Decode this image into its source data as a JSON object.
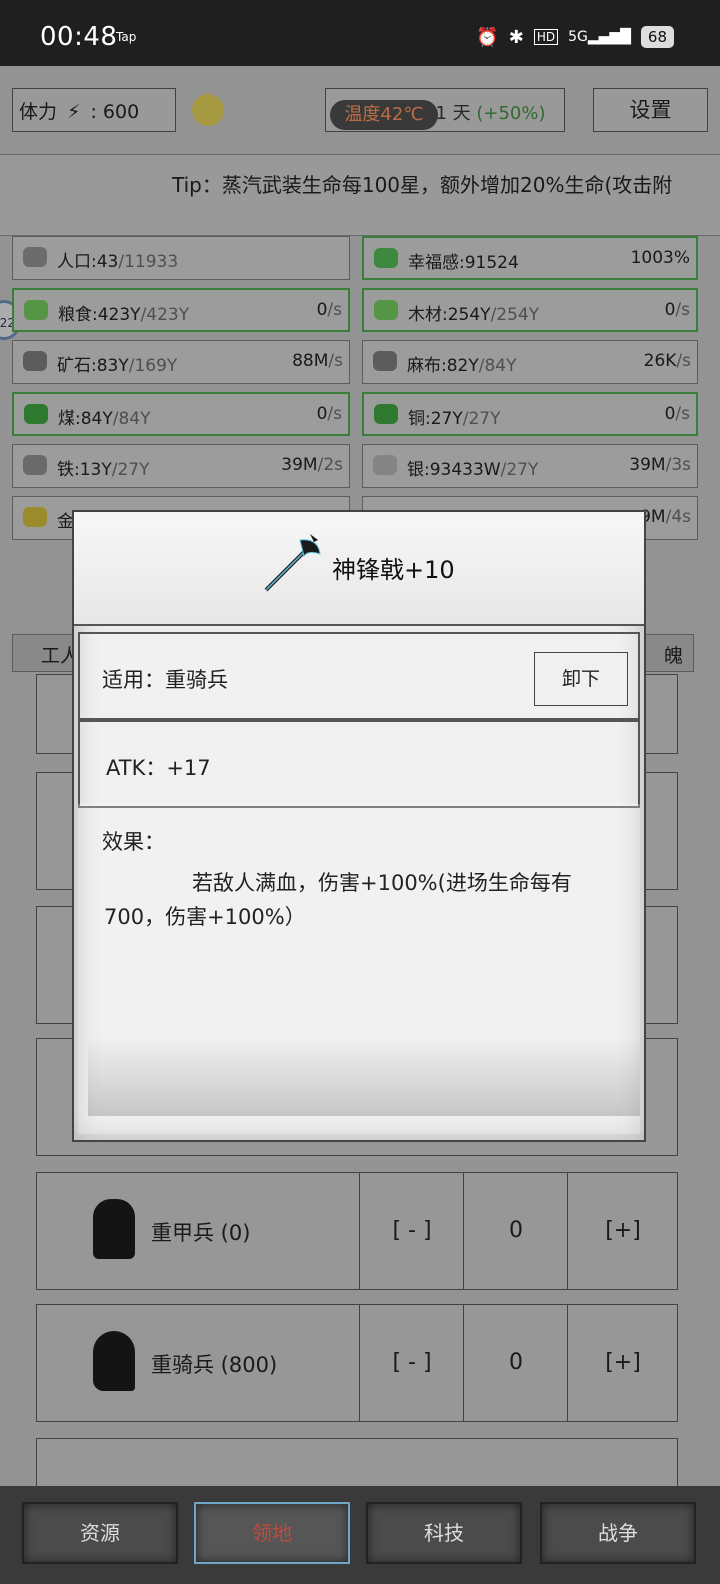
{
  "status_bar": {
    "time": "00:48",
    "tap": "Tap",
    "battery": "68"
  },
  "top": {
    "stamina_label": "体力",
    "stamina_value": ": 600",
    "day_text": "11 天",
    "day_bonus": "(+50%)",
    "temperature": "温度42℃",
    "settings_label": "设置"
  },
  "tip": "Tip：蒸汽武装生命每100星，额外增加20%生命(攻击附",
  "resources": [
    {
      "name": "人口:43",
      "cap": "/11933",
      "rate": "",
      "unit": "",
      "green": false,
      "icon": "people-icon",
      "color": "#8b8b8b"
    },
    {
      "name": "幸福感:91524",
      "cap": "",
      "rate": "1003%",
      "unit": "",
      "green": true,
      "icon": "smile-icon",
      "color": "#4caf50"
    },
    {
      "name": "粮食:423Y",
      "cap": "/423Y",
      "rate": "0",
      "unit": "/s",
      "green": true,
      "icon": "grain-icon",
      "color": "#6cbf5a"
    },
    {
      "name": "木材:254Y",
      "cap": "/254Y",
      "rate": "0",
      "unit": "/s",
      "green": true,
      "icon": "wood-icon",
      "color": "#6cbf5a"
    },
    {
      "name": "矿石:83Y",
      "cap": "/169Y",
      "rate": "88M",
      "unit": "/s",
      "green": false,
      "icon": "ore-icon",
      "color": "#777"
    },
    {
      "name": "麻布:82Y",
      "cap": "/84Y",
      "rate": "26K",
      "unit": "/s",
      "green": false,
      "icon": "linen-icon",
      "color": "#777"
    },
    {
      "name": "煤:84Y",
      "cap": "/84Y",
      "rate": "0",
      "unit": "/s",
      "green": true,
      "icon": "coal-icon",
      "color": "#3d9a3d"
    },
    {
      "name": "铜:27Y",
      "cap": "/27Y",
      "rate": "0",
      "unit": "/s",
      "green": true,
      "icon": "copper-icon",
      "color": "#3d9a3d"
    },
    {
      "name": "铁:13Y",
      "cap": "/27Y",
      "rate": "39M",
      "unit": "/2s",
      "green": false,
      "icon": "iron-icon",
      "color": "#888"
    },
    {
      "name": "银:93433W",
      "cap": "/27Y",
      "rate": "39M",
      "unit": "/3s",
      "green": false,
      "icon": "silver-icon",
      "color": "#aaa"
    },
    {
      "name": "金",
      "cap": "",
      "rate": "",
      "unit": "",
      "green": false,
      "icon": "gold-icon",
      "color": "#c8b23a"
    },
    {
      "name": "",
      "cap": "",
      "rate": "9M",
      "unit": "/4s",
      "green": false,
      "icon": "",
      "color": "#999"
    }
  ],
  "tabs": {
    "left": "工人",
    "right": "魄"
  },
  "units": [
    {
      "label": "重甲兵 (0)",
      "minus": "[ - ]",
      "count": "0",
      "plus": "[+]"
    },
    {
      "label": "重骑兵 (800)",
      "minus": "[ - ]",
      "count": "0",
      "plus": "[+]"
    }
  ],
  "modal": {
    "title": "神锋戟+10",
    "applies": "适用：重骑兵",
    "unequip": "卸下",
    "atk": "ATK：+17",
    "effect_heading": "效果：",
    "effect_body": "若敌人满血，伤害+100%(进场生命每有700，伤害+100%）"
  },
  "side_badge": "22",
  "nav": [
    "资源",
    "领地",
    "科技",
    "战争"
  ],
  "nav_active": "领地"
}
